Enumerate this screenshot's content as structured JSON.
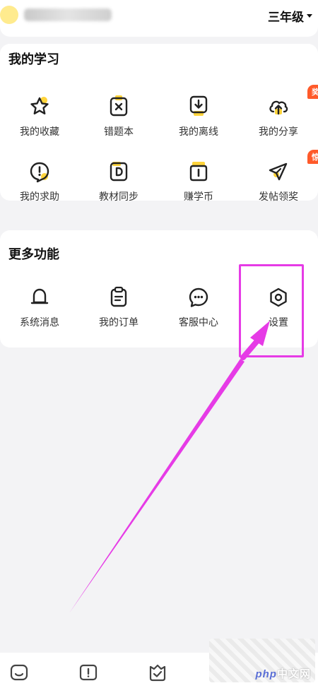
{
  "header": {
    "grade_label": "三年级"
  },
  "my_study": {
    "title": "我的学习",
    "items": [
      {
        "label": "我的收藏",
        "icon": "star-icon"
      },
      {
        "label": "错题本",
        "icon": "wrong-question-icon"
      },
      {
        "label": "我的离线",
        "icon": "download-icon"
      },
      {
        "label": "我的分享",
        "icon": "cloud-upload-icon",
        "badge": "奖励"
      },
      {
        "label": "我的求助",
        "icon": "help-bubble-icon"
      },
      {
        "label": "教材同步",
        "icon": "textbook-icon"
      },
      {
        "label": "赚学币",
        "icon": "coin-icon"
      },
      {
        "label": "发帖领奖",
        "icon": "send-icon",
        "badge": "惊喜"
      }
    ]
  },
  "more_functions": {
    "title": "更多功能",
    "items": [
      {
        "label": "系统消息",
        "icon": "bell-icon"
      },
      {
        "label": "我的订单",
        "icon": "clipboard-icon"
      },
      {
        "label": "客服中心",
        "icon": "chat-icon"
      },
      {
        "label": "设置",
        "icon": "settings-hexagon-icon"
      }
    ]
  },
  "colors": {
    "accent_yellow": "#ffd43b",
    "badge_orange": "#ff5a2a",
    "annotation_magenta": "#e63be6"
  },
  "watermark": {
    "php": "php",
    "site": "中文网"
  }
}
